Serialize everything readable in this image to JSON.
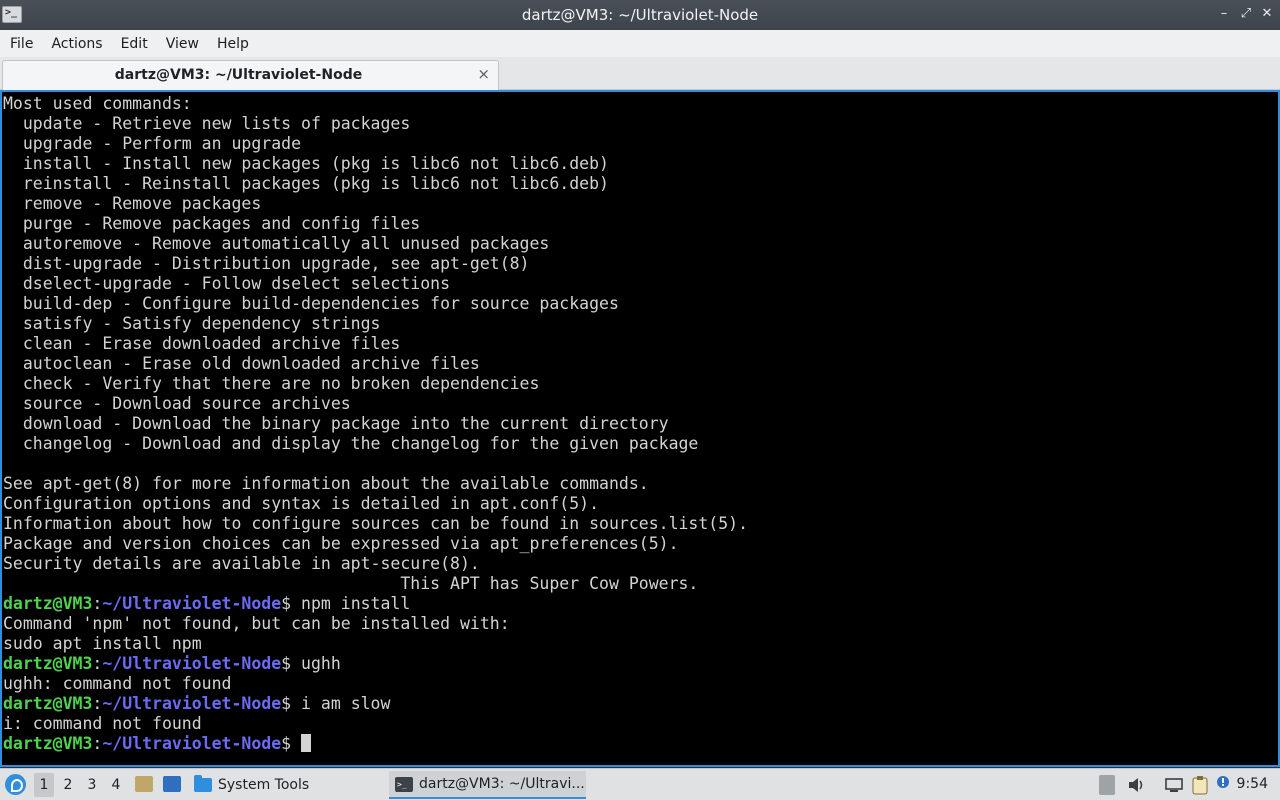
{
  "window": {
    "title": "dartz@VM3: ~/Ultraviolet-Node",
    "controls": {
      "minimize": "–",
      "restore": "⤢",
      "close": "✕"
    }
  },
  "menu": [
    "File",
    "Actions",
    "Edit",
    "View",
    "Help"
  ],
  "tab": {
    "label": "dartz@VM3: ~/Ultraviolet-Node",
    "close": "×"
  },
  "terminal": {
    "output_lines": [
      "Most used commands:",
      "  update - Retrieve new lists of packages",
      "  upgrade - Perform an upgrade",
      "  install - Install new packages (pkg is libc6 not libc6.deb)",
      "  reinstall - Reinstall packages (pkg is libc6 not libc6.deb)",
      "  remove - Remove packages",
      "  purge - Remove packages and config files",
      "  autoremove - Remove automatically all unused packages",
      "  dist-upgrade - Distribution upgrade, see apt-get(8)",
      "  dselect-upgrade - Follow dselect selections",
      "  build-dep - Configure build-dependencies for source packages",
      "  satisfy - Satisfy dependency strings",
      "  clean - Erase downloaded archive files",
      "  autoclean - Erase old downloaded archive files",
      "  check - Verify that there are no broken dependencies",
      "  source - Download source archives",
      "  download - Download the binary package into the current directory",
      "  changelog - Download and display the changelog for the given package",
      "",
      "See apt-get(8) for more information about the available commands.",
      "Configuration options and syntax is detailed in apt.conf(5).",
      "Information about how to configure sources can be found in sources.list(5).",
      "Package and version choices can be expressed via apt_preferences(5).",
      "Security details are available in apt-secure(8).",
      "                                        This APT has Super Cow Powers."
    ],
    "prompt_user": "dartz@VM3",
    "prompt_sep": ":",
    "prompt_path": "~/Ultraviolet-Node",
    "prompt_end": "$ ",
    "sessions": [
      {
        "command": "npm install",
        "output": [
          "Command 'npm' not found, but can be installed with:",
          "sudo apt install npm"
        ]
      },
      {
        "command": "ughh",
        "output": [
          "ughh: command not found"
        ]
      },
      {
        "command": "i am slow",
        "output": [
          "i: command not found"
        ]
      }
    ]
  },
  "taskbar": {
    "workspaces": [
      "1",
      "2",
      "3",
      "4"
    ],
    "active_workspace": "1",
    "system_tools_label": "System Tools",
    "task_label": "dartz@VM3: ~/Ultravi...",
    "clock": "9:54",
    "tray_icons": [
      "trash-icon",
      "volume-icon",
      "display-icon",
      "clipboard-icon",
      "notification-icon"
    ]
  },
  "colors": {
    "prompt_user": "#4ed34e",
    "prompt_path": "#6b6bf5",
    "terminal_bg": "#000000",
    "terminal_fg": "#d3d3d3",
    "accent": "#2f8ede"
  }
}
